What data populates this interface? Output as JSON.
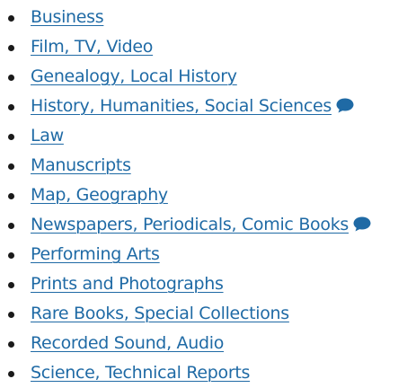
{
  "accent_color": "#1f6aa5",
  "topics": [
    {
      "label": "Business",
      "has_chat": false
    },
    {
      "label": "Film, TV, Video",
      "has_chat": false
    },
    {
      "label": "Genealogy, Local History",
      "has_chat": false
    },
    {
      "label": "History, Humanities, Social Sciences",
      "has_chat": true,
      "icon": "chat-bubble-icon"
    },
    {
      "label": "Law",
      "has_chat": false
    },
    {
      "label": "Manuscripts",
      "has_chat": false
    },
    {
      "label": "Map, Geography",
      "has_chat": false
    },
    {
      "label": "Newspapers, Periodicals, Comic Books",
      "has_chat": true,
      "icon": "chat-bubble-icon"
    },
    {
      "label": "Performing Arts",
      "has_chat": false
    },
    {
      "label": "Prints and Photographs",
      "has_chat": false
    },
    {
      "label": "Rare Books, Special Collections",
      "has_chat": false
    },
    {
      "label": "Recorded Sound, Audio",
      "has_chat": false
    },
    {
      "label": "Science, Technical Reports",
      "has_chat": false
    }
  ]
}
